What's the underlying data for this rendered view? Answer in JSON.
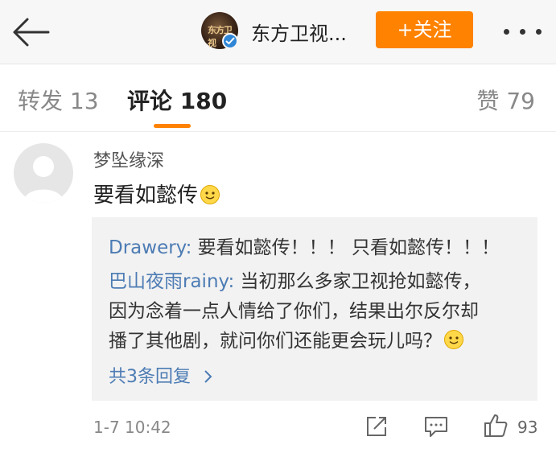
{
  "header": {
    "back_icon": "arrow-left-icon",
    "avatar_logo": "东方卫视",
    "title": "东方卫视...",
    "follow_label": "+关注",
    "more_icon": "more-dots-icon",
    "accent": "#ff8200"
  },
  "tabs": {
    "repost": "转发 13",
    "comments": "评论 180",
    "likes": "赞 79"
  },
  "comment": {
    "username": "梦坠缘深",
    "text": "要看如懿传",
    "emoji": "smile-emoji"
  },
  "replies": {
    "items": [
      {
        "user": "Drawery:",
        "text": " 要看如懿传！！！ 只看如懿传！！！"
      },
      {
        "user": "巴山夜雨rainy:",
        "text": " 当初那么多家卫视抢如懿传，",
        "cont1": "因为念着一点人情给了你们，结果出尔反尔却",
        "cont2": "播了其他剧，就问你们还能更会玩儿吗？"
      }
    ],
    "more_label": "共3条回复",
    "link_color": "#4d7cb4"
  },
  "footer": {
    "time": "1-7 10:42",
    "like_count": "93",
    "icons": [
      "share-icon",
      "reply-icon",
      "thumbs-up-icon"
    ]
  }
}
